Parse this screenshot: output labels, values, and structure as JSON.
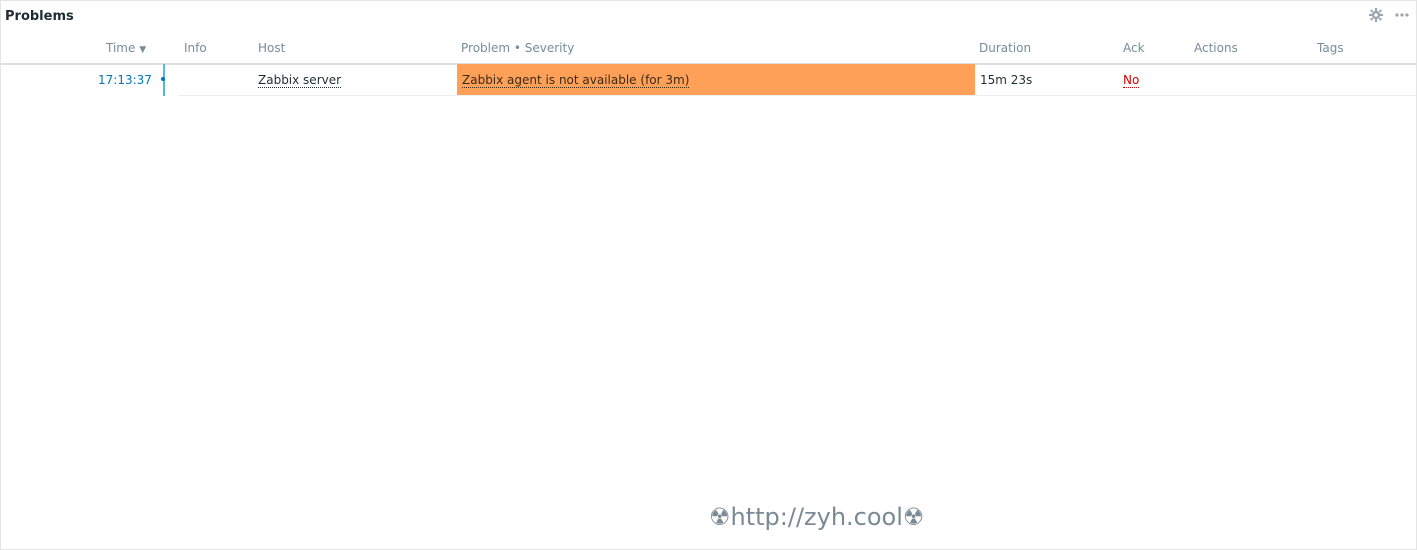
{
  "widget": {
    "title": "Problems",
    "icons": [
      "gear-icon",
      "more-options-icon"
    ]
  },
  "columns": {
    "time": "Time",
    "time_sort_icon": "▼",
    "info": "Info",
    "host": "Host",
    "problem_severity": "Problem • Severity",
    "duration": "Duration",
    "ack": "Ack",
    "actions": "Actions",
    "tags": "Tags"
  },
  "rows": [
    {
      "time": "17:13:37",
      "info": "",
      "host": "Zabbix server",
      "problem": "Zabbix agent is not available (for 3m)",
      "severity_color": "#ffa059",
      "duration": "15m 23s",
      "ack": "No",
      "actions": "",
      "tags": ""
    }
  ],
  "watermark": {
    "text": "☢http://zyh.cool☢"
  }
}
